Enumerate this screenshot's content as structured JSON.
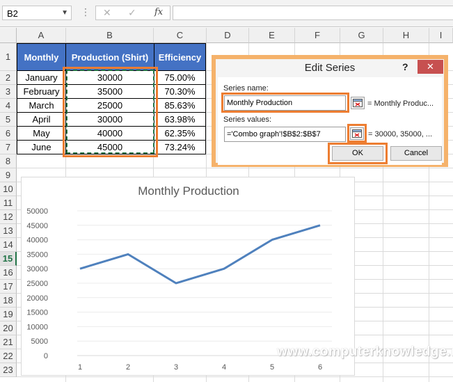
{
  "formula_bar": {
    "name_box": "B2",
    "formula": "",
    "fx_label": "fx"
  },
  "columns": [
    "A",
    "B",
    "C",
    "D",
    "E",
    "F",
    "G",
    "H",
    "I"
  ],
  "selected_row": "15",
  "rows": [
    "1",
    "2",
    "3",
    "4",
    "5",
    "6",
    "7",
    "8",
    "9",
    "10",
    "11",
    "12",
    "13",
    "14",
    "15",
    "16",
    "17",
    "18",
    "19",
    "20",
    "21",
    "22",
    "23"
  ],
  "table": {
    "headers": [
      "Monthly",
      "Production (Shirt)",
      "Efficiency"
    ],
    "rows": [
      [
        "January",
        "30000",
        "75.00%"
      ],
      [
        "February",
        "35000",
        "70.30%"
      ],
      [
        "March",
        "25000",
        "85.63%"
      ],
      [
        "April",
        "30000",
        "63.98%"
      ],
      [
        "May",
        "40000",
        "62.35%"
      ],
      [
        "June",
        "45000",
        "73.24%"
      ]
    ]
  },
  "dialog": {
    "title": "Edit Series",
    "help": "?",
    "close": "✕",
    "series_name_label": "Series name:",
    "series_name_value": "Monthly Production",
    "series_name_preview": "= Monthly Produc...",
    "series_values_label": "Series values:",
    "series_values_value": "='Combo graph'!$B$2:$B$7",
    "series_values_preview": "= 30000, 35000, ...",
    "ok_label": "OK",
    "cancel_label": "Cancel"
  },
  "colors": {
    "header_blue": "#4472c4",
    "highlight_orange": "#ed7d31",
    "line_blue": "#4f81bd",
    "excel_green": "#217346"
  },
  "chart_data": {
    "type": "line",
    "title": "Monthly Production",
    "x": [
      1,
      2,
      3,
      4,
      5,
      6
    ],
    "series": [
      {
        "name": "Monthly Production",
        "values": [
          30000,
          35000,
          25000,
          30000,
          40000,
          45000
        ]
      }
    ],
    "yticks": [
      0,
      5000,
      10000,
      15000,
      20000,
      25000,
      30000,
      35000,
      40000,
      45000,
      50000
    ],
    "ylim": [
      0,
      50000
    ],
    "grid": true,
    "legend": "none"
  },
  "watermark": "www.computerknowledge.net"
}
